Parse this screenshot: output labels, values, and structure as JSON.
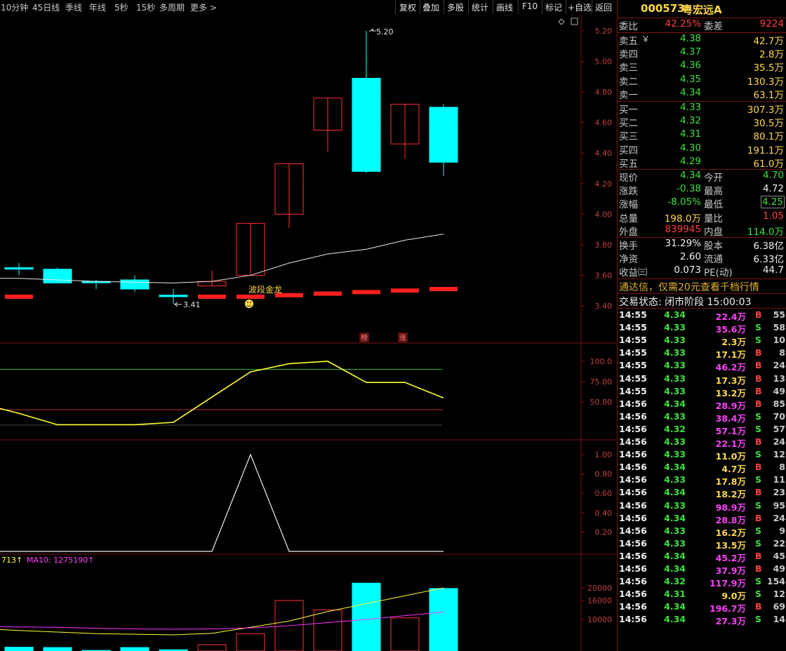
{
  "toolbar": {
    "periods": [
      "10分钟",
      "45日线",
      "季线",
      "年线",
      "5秒",
      "15秒",
      "多周期",
      "更多 >"
    ],
    "buttons": [
      "复权",
      "叠加",
      "多股",
      "统计",
      "画线",
      "F10",
      "标记",
      "+自选",
      "返回"
    ]
  },
  "stock": {
    "code": "000573",
    "name": "粤宏远A"
  },
  "order_book": {
    "wei_bi_label": "委比",
    "wei_bi": "42.25%",
    "wei_cha_label": "委差",
    "wei_cha": "9224",
    "asks": [
      {
        "label": "卖五",
        "flag": "￥",
        "price": "4.38",
        "vol": "42.7万"
      },
      {
        "label": "卖四",
        "price": "4.37",
        "vol": "2.8万"
      },
      {
        "label": "卖三",
        "price": "4.36",
        "vol": "35.5万"
      },
      {
        "label": "卖二",
        "price": "4.35",
        "vol": "130.3万"
      },
      {
        "label": "卖一",
        "price": "4.34",
        "vol": "63.1万"
      }
    ],
    "bids": [
      {
        "label": "买一",
        "price": "4.33",
        "vol": "307.3万"
      },
      {
        "label": "买二",
        "price": "4.32",
        "vol": "30.5万"
      },
      {
        "label": "买三",
        "price": "4.31",
        "vol": "80.1万"
      },
      {
        "label": "买四",
        "price": "4.30",
        "vol": "191.1万"
      },
      {
        "label": "买五",
        "price": "4.29",
        "vol": "61.0万"
      }
    ]
  },
  "quote": [
    {
      "l1": "现价",
      "v1": "4.34",
      "c1": "green",
      "l2": "今开",
      "v2": "4.70",
      "c2": "green"
    },
    {
      "l1": "涨跌",
      "v1": "-0.38",
      "c1": "green",
      "l2": "最高",
      "v2": "4.72",
      "c2": "white"
    },
    {
      "l1": "涨幅",
      "v1": "-8.05%",
      "c1": "green",
      "l2": "最低",
      "v2": "4.25",
      "c2": "green"
    },
    {
      "l1": "总量",
      "v1": "198.0万",
      "c1": "yellow",
      "l2": "量比",
      "v2": "1.05",
      "c2": "red"
    },
    {
      "l1": "外盘",
      "v1": "839945",
      "c1": "red",
      "l2": "内盘",
      "v2": "114.0万",
      "c2": "green"
    }
  ],
  "fundamentals": [
    {
      "l1": "换手",
      "v1": "31.29%",
      "l2": "股本",
      "v2": "6.38亿"
    },
    {
      "l1": "净资",
      "v1": "2.60",
      "l2": "流通",
      "v2": "6.33亿"
    },
    {
      "l1": "收益㈢",
      "v1": "0.073",
      "l2": "PE(动)",
      "v2": "44.7"
    }
  ],
  "promo": "通达信，仅需20元查看千档行情",
  "trade_status": "交易状态: 闭市阶段 15:00:03",
  "ticks": [
    {
      "t": "14:55",
      "p": "4.34",
      "v": "22.4万",
      "bs": "B",
      "n": "55"
    },
    {
      "t": "14:55",
      "p": "4.33",
      "v": "35.6万",
      "bs": "S",
      "n": "58"
    },
    {
      "t": "14:55",
      "p": "4.33",
      "v": "2.3万",
      "bs": "S",
      "n": "10"
    },
    {
      "t": "14:55",
      "p": "4.33",
      "v": "17.1万",
      "bs": "B",
      "n": "8"
    },
    {
      "t": "14:55",
      "p": "4.33",
      "v": "46.2万",
      "bs": "B",
      "n": "24"
    },
    {
      "t": "14:55",
      "p": "4.33",
      "v": "17.3万",
      "bs": "B",
      "n": "13"
    },
    {
      "t": "14:55",
      "p": "4.33",
      "v": "13.2万",
      "bs": "B",
      "n": "49"
    },
    {
      "t": "14:56",
      "p": "4.34",
      "v": "28.9万",
      "bs": "B",
      "n": "85"
    },
    {
      "t": "14:56",
      "p": "4.33",
      "v": "38.4万",
      "bs": "S",
      "n": "70"
    },
    {
      "t": "14:56",
      "p": "4.32",
      "v": "57.1万",
      "bs": "S",
      "n": "57"
    },
    {
      "t": "14:56",
      "p": "4.33",
      "v": "22.1万",
      "bs": "B",
      "n": "24"
    },
    {
      "t": "14:56",
      "p": "4.33",
      "v": "11.0万",
      "bs": "S",
      "n": "12"
    },
    {
      "t": "14:56",
      "p": "4.34",
      "v": "4.7万",
      "bs": "B",
      "n": "8"
    },
    {
      "t": "14:56",
      "p": "4.33",
      "v": "17.8万",
      "bs": "S",
      "n": "11"
    },
    {
      "t": "14:56",
      "p": "4.34",
      "v": "18.2万",
      "bs": "B",
      "n": "23"
    },
    {
      "t": "14:56",
      "p": "4.33",
      "v": "98.9万",
      "bs": "S",
      "n": "95"
    },
    {
      "t": "14:56",
      "p": "4.34",
      "v": "28.8万",
      "bs": "B",
      "n": "24"
    },
    {
      "t": "14:56",
      "p": "4.33",
      "v": "16.2万",
      "bs": "S",
      "n": "9"
    },
    {
      "t": "14:56",
      "p": "4.33",
      "v": "13.5万",
      "bs": "S",
      "n": "22"
    },
    {
      "t": "14:56",
      "p": "4.34",
      "v": "45.2万",
      "bs": "B",
      "n": "45"
    },
    {
      "t": "14:56",
      "p": "4.34",
      "v": "37.9万",
      "bs": "B",
      "n": "49"
    },
    {
      "t": "14:56",
      "p": "4.32",
      "v": "117.9万",
      "bs": "S",
      "n": "154"
    },
    {
      "t": "14:56",
      "p": "4.31",
      "v": "9.0万",
      "bs": "S",
      "n": "12"
    },
    {
      "t": "14:56",
      "p": "4.34",
      "v": "196.7万",
      "bs": "B",
      "n": "69"
    },
    {
      "t": "14:56",
      "p": "4.34",
      "v": "27.3万",
      "bs": "S",
      "n": "14"
    }
  ],
  "chart_data": [
    {
      "type": "candlestick",
      "yticks": [
        "5.20",
        "5.00",
        "4.80",
        "4.60",
        "4.40",
        "4.20",
        "4.00",
        "3.80",
        "3.60",
        "3.40"
      ],
      "candles": [
        {
          "open": 3.65,
          "close": 3.64,
          "high": 3.68,
          "low": 3.6
        },
        {
          "open": 3.64,
          "close": 3.55,
          "high": 3.65,
          "low": 3.55
        },
        {
          "open": 3.56,
          "close": 3.56,
          "high": 3.57,
          "low": 3.51
        },
        {
          "open": 3.57,
          "close": 3.51,
          "high": 3.6,
          "low": 3.49
        },
        {
          "open": 3.47,
          "close": 3.46,
          "high": 3.51,
          "low": 3.41
        },
        {
          "open": 3.53,
          "close": 3.56,
          "high": 3.63,
          "low": 3.53
        },
        {
          "open": 3.6,
          "close": 3.94,
          "high": 3.94,
          "low": 3.6
        },
        {
          "open": 4.0,
          "close": 4.33,
          "high": 4.33,
          "low": 3.91
        },
        {
          "open": 4.55,
          "close": 4.76,
          "high": 4.76,
          "low": 4.41
        },
        {
          "open": 4.89,
          "close": 4.28,
          "high": 5.2,
          "low": 4.27
        },
        {
          "open": 4.46,
          "close": 4.72,
          "high": 4.72,
          "low": 4.36
        },
        {
          "open": 4.7,
          "close": 4.34,
          "high": 4.72,
          "low": 4.25
        }
      ],
      "ma_line": [
        3.58,
        3.57,
        3.56,
        3.555,
        3.55,
        3.56,
        3.6,
        3.68,
        3.74,
        3.77,
        3.83,
        3.87
      ],
      "bottom_marks": [
        3.46,
        null,
        null,
        null,
        null,
        3.46,
        3.46,
        3.47,
        3.48,
        3.49,
        3.5,
        3.51
      ],
      "annotations": {
        "high_label": "5.20",
        "low_label": "3.41",
        "signal": "波段金龙",
        "tag1": "榜",
        "tag2": "涨"
      }
    },
    {
      "type": "line",
      "yticks": [
        "100.0",
        "75.00",
        "50.00"
      ],
      "series": [
        {
          "values": [
            36,
            22,
            22,
            22,
            25,
            56,
            87,
            97,
            100,
            74,
            74,
            55
          ]
        }
      ],
      "ref_green": 90,
      "ref_red": 50
    },
    {
      "type": "line",
      "yticks": [
        "1.00",
        "0.80",
        "0.60",
        "0.40",
        "0.20"
      ],
      "series": [
        {
          "values": [
            0,
            0,
            0,
            0,
            0,
            0,
            1,
            0,
            0,
            0,
            0,
            0
          ]
        }
      ]
    },
    {
      "type": "bar",
      "yticks": [
        "20000",
        "16000",
        "10000"
      ],
      "legend_left": "713↑",
      "legend_ma": "MA10: 1275190↑",
      "values": [
        1200,
        1100,
        200,
        1100,
        400,
        2000,
        5500,
        16000,
        13000,
        21500,
        10500,
        19800
      ],
      "ma5": [
        6500,
        6000,
        5500,
        5300,
        5100,
        5600,
        7500,
        9500,
        12500,
        15000,
        17500,
        20000
      ],
      "ma10": [
        7600,
        7500,
        7200,
        7000,
        6900,
        7000,
        7300,
        8000,
        9000,
        10000,
        11200,
        12300
      ]
    }
  ]
}
